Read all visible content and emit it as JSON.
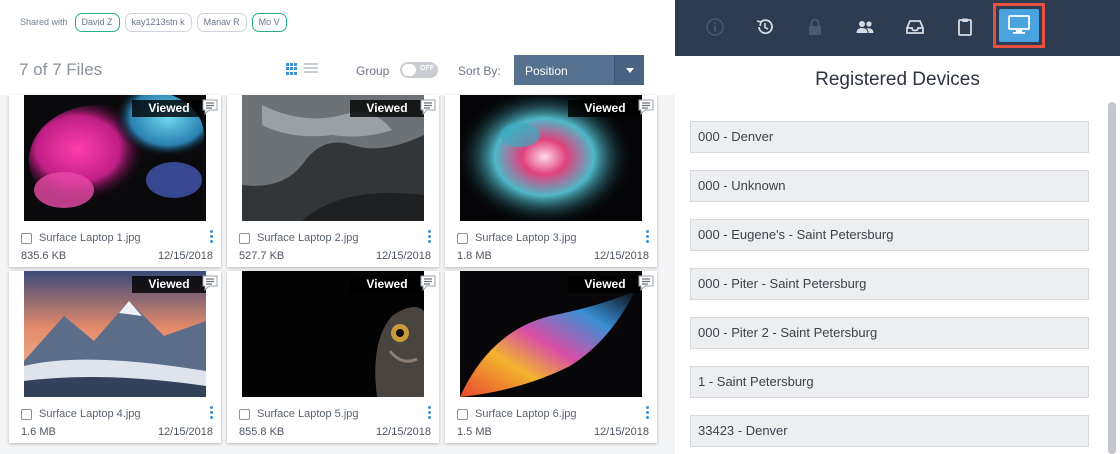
{
  "shared": {
    "label": "Shared with",
    "users": [
      {
        "name": "David Z",
        "active": true
      },
      {
        "name": "kay1213stn k",
        "active": false
      },
      {
        "name": "Manav R",
        "active": false
      },
      {
        "name": "Mo V",
        "active": true
      }
    ]
  },
  "toolbar": {
    "files_count": "7 of 7 Files",
    "group_label": "Group",
    "group_toggle": "OFF",
    "sort_label": "Sort By:",
    "sort_value": "Position"
  },
  "files": [
    {
      "name": "Surface Laptop 1.jpg",
      "size": "835.6 KB",
      "date": "12/15/2018",
      "badge": "Viewed",
      "theme": "pink-smoke"
    },
    {
      "name": "Surface Laptop 2.jpg",
      "size": "527.7 KB",
      "date": "12/15/2018",
      "badge": "Viewed",
      "theme": "grey-aerial"
    },
    {
      "name": "Surface Laptop 3.jpg",
      "size": "1.8 MB",
      "date": "12/15/2018",
      "badge": "Viewed",
      "theme": "color-burst"
    },
    {
      "name": "Surface Laptop 4.jpg",
      "size": "1.6 MB",
      "date": "12/15/2018",
      "badge": "Viewed",
      "theme": "mountains"
    },
    {
      "name": "Surface Laptop 5.jpg",
      "size": "855.8 KB",
      "date": "12/15/2018",
      "badge": "Viewed",
      "theme": "owl"
    },
    {
      "name": "Surface Laptop 6.jpg",
      "size": "1.5 MB",
      "date": "12/15/2018",
      "badge": "Viewed",
      "theme": "rainbow-powder"
    }
  ],
  "right_panel": {
    "toolbar_icons": [
      "info-icon",
      "history-icon",
      "lock-icon",
      "users-icon",
      "inbox-icon",
      "clipboard-icon",
      "monitor-icon"
    ],
    "active_icon": "monitor-icon",
    "title": "Registered Devices",
    "devices": [
      "000 - Denver",
      "000 - Unknown",
      "000 - Eugene's - Saint Petersburg",
      "000 - Piter - Saint Petersburg",
      "000 - Piter 2 - Saint Petersburg",
      "1 - Saint Petersburg",
      "33423 - Denver"
    ]
  },
  "colors": {
    "accent": "#3d8fd6",
    "topbar": "#2e3c52",
    "active_highlight": "#e8503f",
    "chip_active": "#27ae86",
    "sort_bg": "#56708f"
  }
}
